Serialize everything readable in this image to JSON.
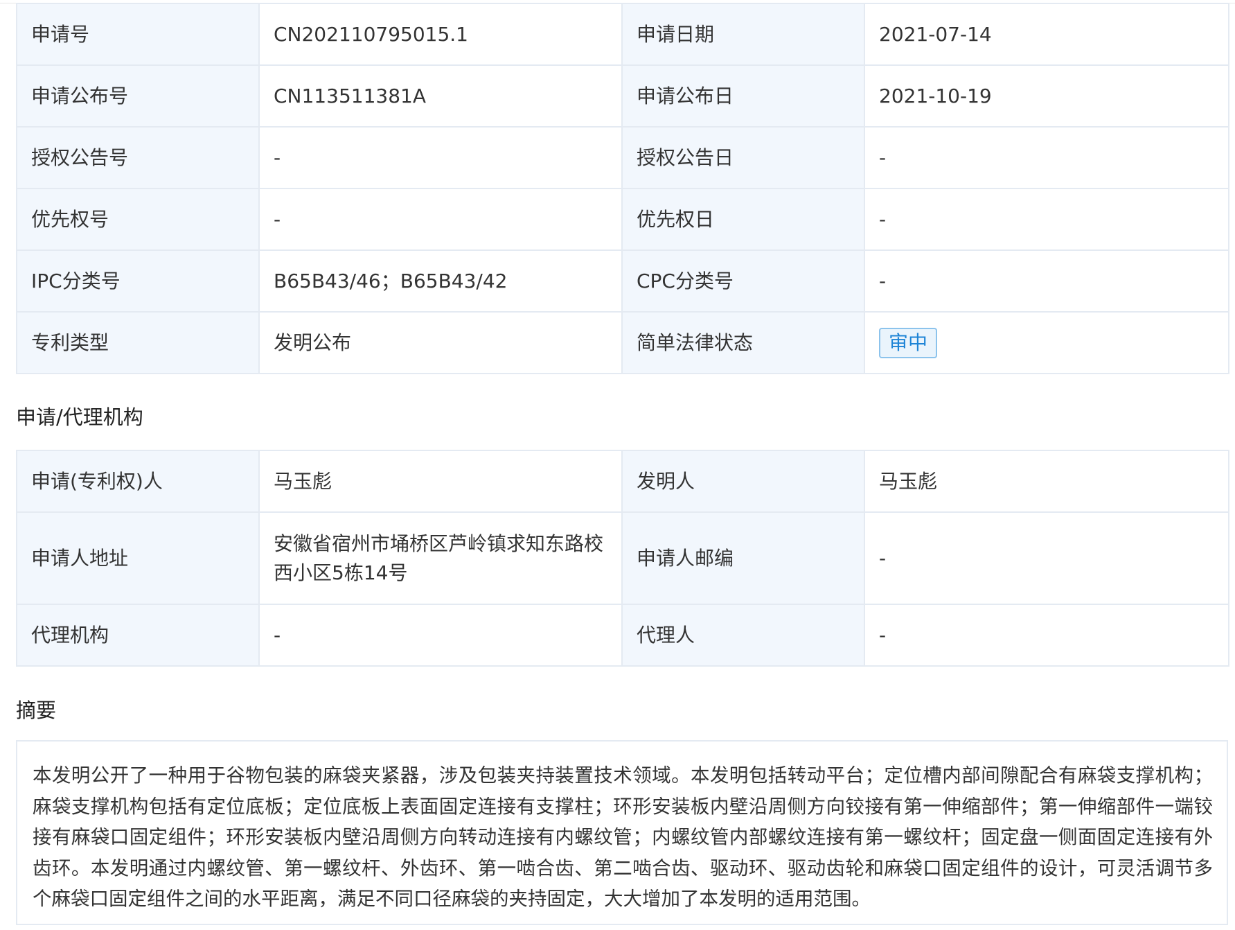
{
  "basic_info": {
    "rows": [
      {
        "label1": "申请号",
        "value1": "CN202110795015.1",
        "label2": "申请日期",
        "value2": "2021-07-14"
      },
      {
        "label1": "申请公布号",
        "value1": "CN113511381A",
        "label2": "申请公布日",
        "value2": "2021-10-19"
      },
      {
        "label1": "授权公告号",
        "value1": "-",
        "label2": "授权公告日",
        "value2": "-"
      },
      {
        "label1": "优先权号",
        "value1": "-",
        "label2": "优先权日",
        "value2": "-"
      },
      {
        "label1": "IPC分类号",
        "value1": "B65B43/46；B65B43/42",
        "label2": "CPC分类号",
        "value2": "-"
      },
      {
        "label1": "专利类型",
        "value1": "发明公布",
        "label2": "简单法律状态",
        "value2": "审中"
      }
    ]
  },
  "agency_section": {
    "title": "申请/代理机构",
    "rows": [
      {
        "label1": "申请(专利权)人",
        "value1": "马玉彪",
        "label2": "发明人",
        "value2": "马玉彪"
      },
      {
        "label1": "申请人地址",
        "value1": "安徽省宿州市埇桥区芦岭镇求知东路校西小区5栋14号",
        "label2": "申请人邮编",
        "value2": "-"
      },
      {
        "label1": "代理机构",
        "value1": "-",
        "label2": "代理人",
        "value2": "-"
      }
    ]
  },
  "abstract_section": {
    "title": "摘要",
    "text": "本发明公开了一种用于谷物包装的麻袋夹紧器，涉及包装夹持装置技术领域。本发明包括转动平台；定位槽内部间隙配合有麻袋支撑机构；麻袋支撑机构包括有定位底板；定位底板上表面固定连接有支撑柱；环形安装板内壁沿周侧方向铰接有第一伸缩部件；第一伸缩部件一端铰接有麻袋口固定组件；环形安装板内壁沿周侧方向转动连接有内螺纹管；内螺纹管内部螺纹连接有第一螺纹杆；固定盘一侧面固定连接有外齿环。本发明通过内螺纹管、第一螺纹杆、外齿环、第一啮合齿、第二啮合齿、驱动环、驱动齿轮和麻袋口固定组件的设计，可灵活调节多个麻袋口固定组件之间的水平距离，满足不同口径麻袋的夹持固定，大大增加了本发明的适用范围。"
  },
  "colors": {
    "label_bg": "#f2f7fd",
    "border": "#e4eaf2",
    "status_text": "#1e84d6",
    "status_border": "#8cc3ec"
  }
}
